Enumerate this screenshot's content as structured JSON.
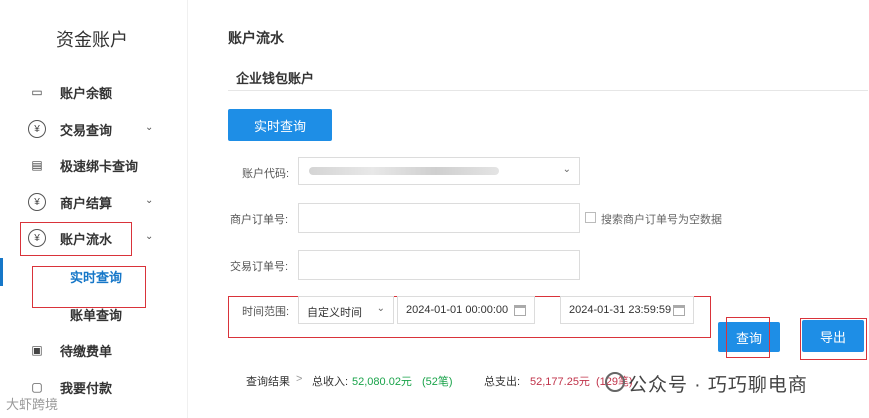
{
  "sidebar": {
    "title": "资金账户",
    "items": [
      {
        "label": "账户余额",
        "icon": "folder-icon"
      },
      {
        "label": "交易查询",
        "icon": "yen-icon"
      },
      {
        "label": "极速绑卡查询",
        "icon": "card-icon"
      },
      {
        "label": "商户结算",
        "icon": "yen-icon"
      },
      {
        "label": "账户流水",
        "icon": "yen-icon"
      }
    ],
    "subitems": [
      {
        "label": "实时查询",
        "active": true
      },
      {
        "label": "账单查询",
        "active": false
      }
    ],
    "more_items": [
      {
        "label": "待缴费单",
        "icon": "receipt-icon"
      },
      {
        "label": "我要付款",
        "icon": "pay-icon"
      }
    ],
    "icon_glyphs": {
      "yen": "¥",
      "folder": "▭",
      "card": "▤",
      "receipt": "▣",
      "pay": "▢"
    },
    "chevron_glyph": "⌄"
  },
  "main": {
    "title": "账户流水",
    "section_tab": "企业钱包账户",
    "realtime_button": "实时查询",
    "form": {
      "account_code_label": "账户代码:",
      "merchant_order_label": "商户订单号:",
      "merchant_order_value": "",
      "empty_order_checkbox_label": "搜索商户订单号为空数据",
      "transaction_order_label": "交易订单号:",
      "transaction_order_value": "",
      "time_range_label": "时间范围:",
      "time_range_select": "自定义时间",
      "start_time": "2024-01-01 00:00:00",
      "end_time": "2024-01-31 23:59:59",
      "select_arrow": "⌄"
    },
    "query_button": "查询",
    "export_button": "导出",
    "summary": {
      "label": "查询结果",
      "separator": ">",
      "income_label": "总收入:",
      "income_value": "52,080.02元",
      "income_count": "(52笔)",
      "expense_label": "总支出:",
      "expense_value": "52,177.25元",
      "expense_count": "(129笔)"
    }
  },
  "watermark": {
    "text": "公众号 · 巧巧聊电商",
    "bottom_text": "大虾跨境"
  },
  "colors": {
    "accent": "#1e8ee6",
    "highlight_box": "#d9333a",
    "active_text": "#1677c8",
    "income": "#1aa34a",
    "expense": "#c0334a"
  }
}
